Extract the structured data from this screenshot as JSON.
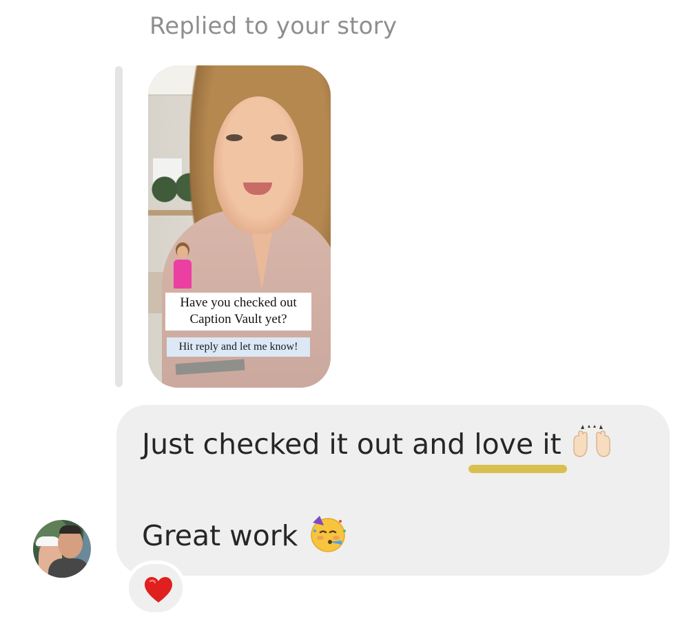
{
  "reply": {
    "header_text": "Replied to your story"
  },
  "story": {
    "caption_line_1": "Have you checked out",
    "caption_line_2": "Caption Vault yet?",
    "prompt_text": "Hit reply and let me know!"
  },
  "message": {
    "line1_prefix": "Just checked it out and ",
    "line1_highlight": "love it",
    "line1_emoji": "raising-hands-emoji",
    "line2_text": "Great work",
    "line2_emoji": "partying-face-emoji",
    "highlight_color": "#d9bf4f"
  },
  "reaction": {
    "emoji": "red-heart-emoji",
    "color": "#e0201f"
  },
  "colors": {
    "bubble_background": "#efefef",
    "header_text": "#8e8e8e",
    "quote_bar": "#e4e4e4"
  }
}
